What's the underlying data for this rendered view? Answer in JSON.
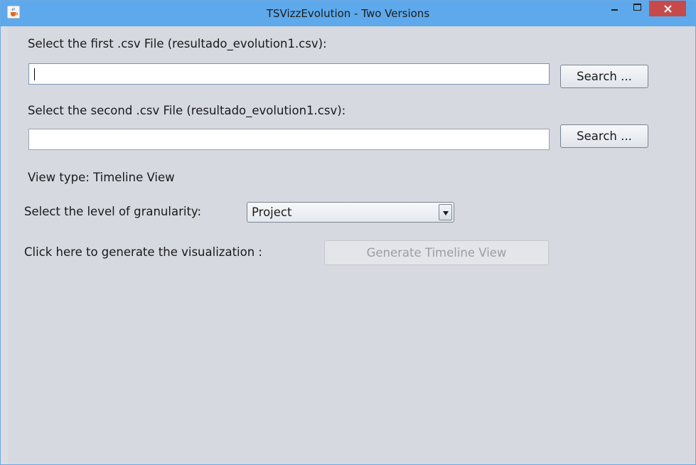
{
  "window": {
    "title": "TSVizzEvolution - Two Versions"
  },
  "icons": {
    "app": "java-coffee-icon",
    "minimize": "minimize-icon",
    "maximize": "maximize-icon",
    "close": "close-icon",
    "dropdown": "chevron-down-icon"
  },
  "colors": {
    "titlebar": "#5ea9eb",
    "close_button": "#c74a4a",
    "panel_background": "#d6d9df"
  },
  "first_file": {
    "label": "Select the first .csv File (resultado_evolution1.csv):",
    "value": "",
    "search_label": "Search ..."
  },
  "second_file": {
    "label": "Select the second .csv File (resultado_evolution1.csv):",
    "value": "",
    "search_label": "Search ..."
  },
  "view_type": {
    "text": "View type: Timeline View"
  },
  "granularity": {
    "label": "Select the level of granularity:",
    "selected": "Project"
  },
  "generate": {
    "label": "Click here to generate the visualization :",
    "button_label": "Generate Timeline View",
    "enabled": false
  }
}
